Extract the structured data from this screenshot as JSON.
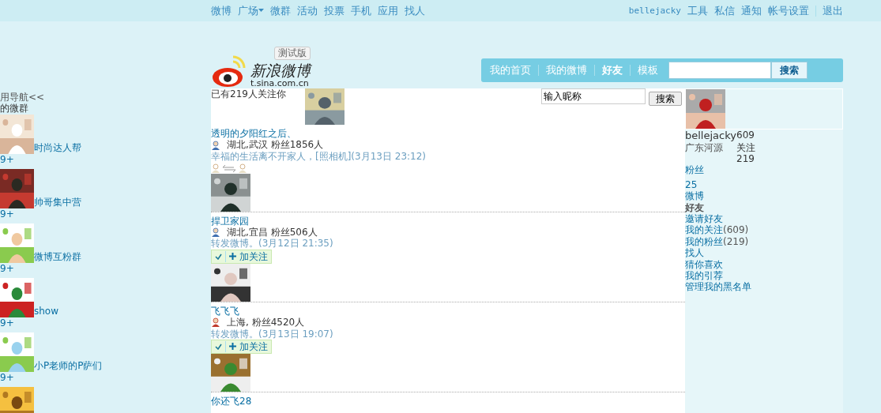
{
  "top_nav": {
    "links": [
      {
        "label": "微博",
        "dropdown": false
      },
      {
        "label": "广场",
        "dropdown": true
      },
      {
        "label": "微群",
        "dropdown": false
      },
      {
        "label": "活动",
        "dropdown": false
      },
      {
        "label": "投票",
        "dropdown": false
      },
      {
        "label": "手机",
        "dropdown": false
      },
      {
        "label": "应用",
        "dropdown": false
      },
      {
        "label": "找人",
        "dropdown": false
      }
    ],
    "account": [
      "bellejacky",
      "工具",
      "私信",
      "通知",
      "帐号设置",
      "退出"
    ]
  },
  "logo": {
    "name": "新浪微博",
    "domain": "t.sina.com.cn",
    "badge": "测试版"
  },
  "main_nav": {
    "tabs": [
      {
        "label": "我的首页",
        "selected": false
      },
      {
        "label": "我的微博",
        "selected": false
      },
      {
        "label": "好友",
        "selected": true
      },
      {
        "label": "模板",
        "selected": false
      }
    ],
    "search_button": "搜索"
  },
  "sidebar": {
    "title": "用导航<<",
    "subtitle": "的微群",
    "groups": [
      {
        "name": "时尚达人帮",
        "count": "9+"
      },
      {
        "name": "帅哥集中营",
        "count": "9+"
      },
      {
        "name": "微博互粉群",
        "count": "9+"
      },
      {
        "name": "show",
        "count": "9+"
      },
      {
        "name": "小P老师的P萨们",
        "count": "9+"
      }
    ]
  },
  "center": {
    "followers_note": "已有219人关注你",
    "search": {
      "value": "输入昵称"
    },
    "search_button": "搜索",
    "users": [
      {
        "name": "透明的夕阳红之后、",
        "female": false,
        "location": "湖北,武汉  粉丝1856人",
        "status": "幸福的生活离不开家人，[照相机](3月13日  23:12)",
        "kind": "mutual"
      },
      {
        "name": "捍卫家园",
        "female": false,
        "location": "湖北,宜昌  粉丝506人",
        "status": "转发微博。(3月12日  21:35)",
        "kind": "follow",
        "follow_label": "加关注"
      },
      {
        "name": "飞飞飞",
        "female": true,
        "location": "上海, 粉丝4520人",
        "status": "转发微博。(3月13日  19:07)",
        "kind": "follow",
        "follow_label": "加关注"
      }
    ],
    "cut_name": "你还飞28"
  },
  "profile": {
    "name": "bellejacky",
    "location": "广东河源",
    "following_count": "609",
    "following_label": "关注",
    "followers_count": "219",
    "followers_label": "粉丝",
    "posts_count": "25",
    "posts_label": "微博",
    "section_title": "好友",
    "menu": [
      {
        "label": "邀请好友"
      },
      {
        "label": "我的关注",
        "count": "(609)"
      },
      {
        "label": "我的粉丝",
        "count": "(219)"
      },
      {
        "label": "找人"
      },
      {
        "label": "猜你喜欢"
      },
      {
        "label": "我的引荐"
      },
      {
        "label": "管理我的黑名单"
      }
    ]
  }
}
